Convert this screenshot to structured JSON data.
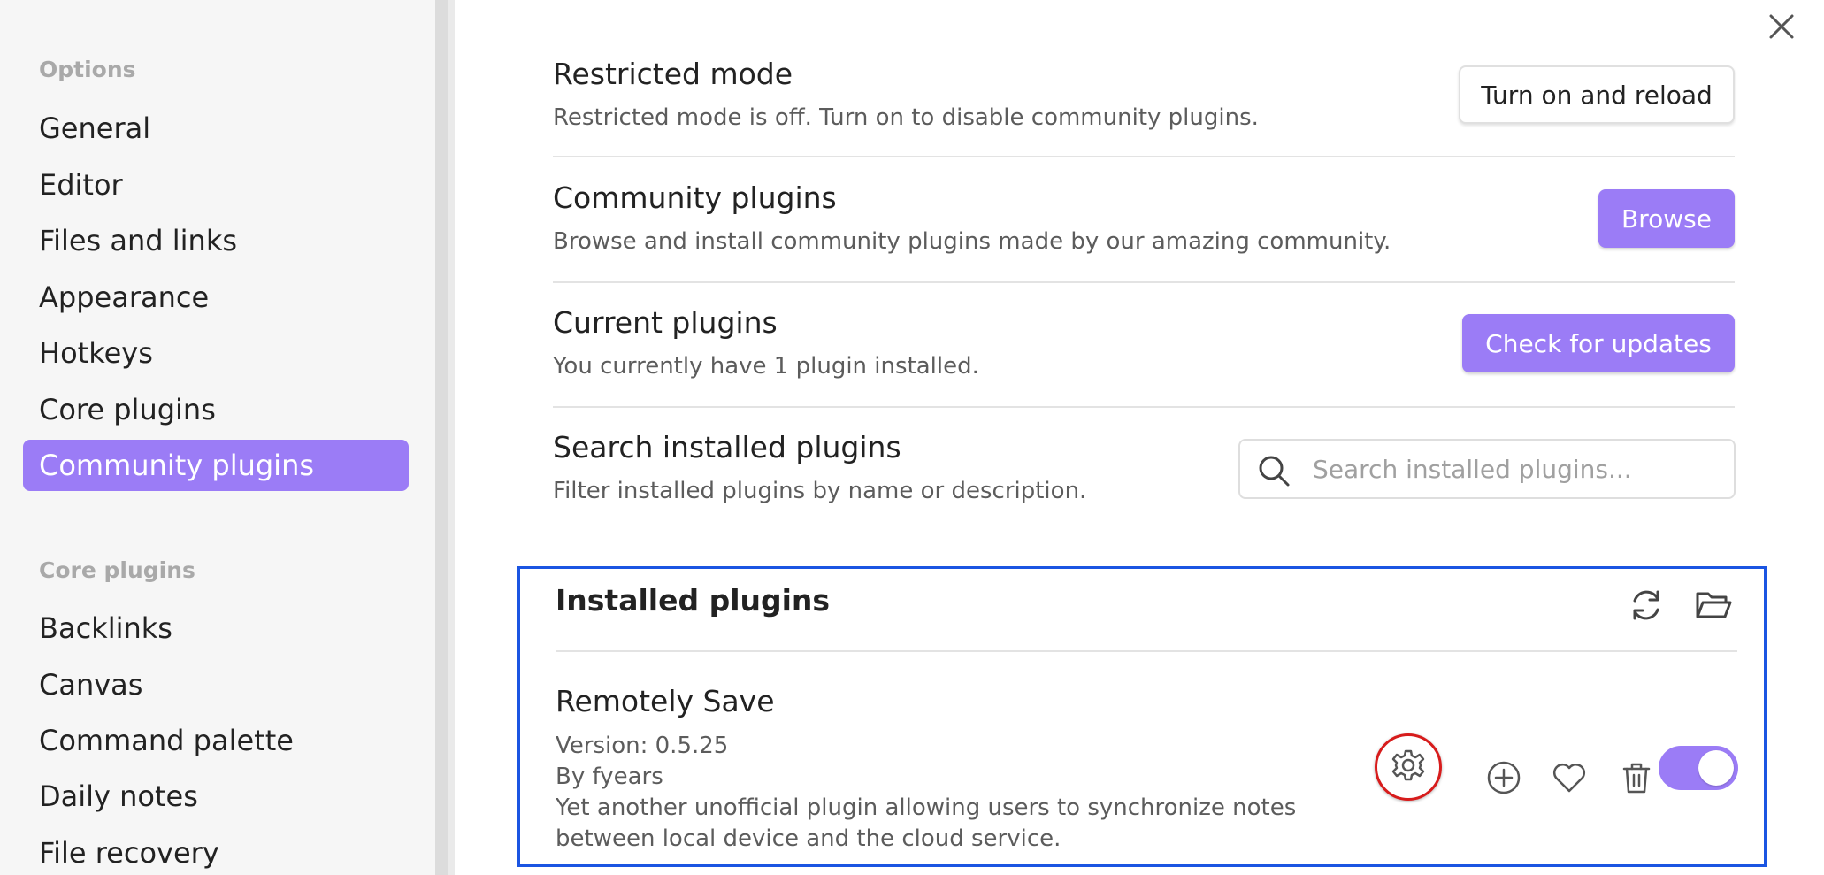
{
  "sidebar": {
    "sections": [
      {
        "heading": "Options",
        "items": [
          {
            "label": "General"
          },
          {
            "label": "Editor"
          },
          {
            "label": "Files and links"
          },
          {
            "label": "Appearance"
          },
          {
            "label": "Hotkeys"
          },
          {
            "label": "Core plugins"
          },
          {
            "label": "Community plugins",
            "active": true
          }
        ]
      },
      {
        "heading": "Core plugins",
        "items": [
          {
            "label": "Backlinks"
          },
          {
            "label": "Canvas"
          },
          {
            "label": "Command palette"
          },
          {
            "label": "Daily notes"
          },
          {
            "label": "File recovery"
          }
        ]
      }
    ]
  },
  "settings": {
    "restricted": {
      "title": "Restricted mode",
      "desc": "Restricted mode is off. Turn on to disable community plugins.",
      "button": "Turn on and reload"
    },
    "community": {
      "title": "Community plugins",
      "desc": "Browse and install community plugins made by our amazing community.",
      "button": "Browse"
    },
    "current": {
      "title": "Current plugins",
      "desc": "You currently have 1 plugin installed.",
      "button": "Check for updates"
    },
    "search": {
      "title": "Search installed plugins",
      "desc": "Filter installed plugins by name or description.",
      "placeholder": "Search installed plugins..."
    }
  },
  "installed": {
    "title": "Installed plugins",
    "plugin": {
      "name": "Remotely Save",
      "version": "Version: 0.5.25",
      "author": "By fyears",
      "description": "Yet another unofficial plugin allowing users to synchronize notes between local device and the cloud service.",
      "enabled": true
    }
  },
  "colors": {
    "accent": "#9b7cf6",
    "highlight_box": "#1b55e2",
    "highlight_circle": "#d71c1c"
  }
}
